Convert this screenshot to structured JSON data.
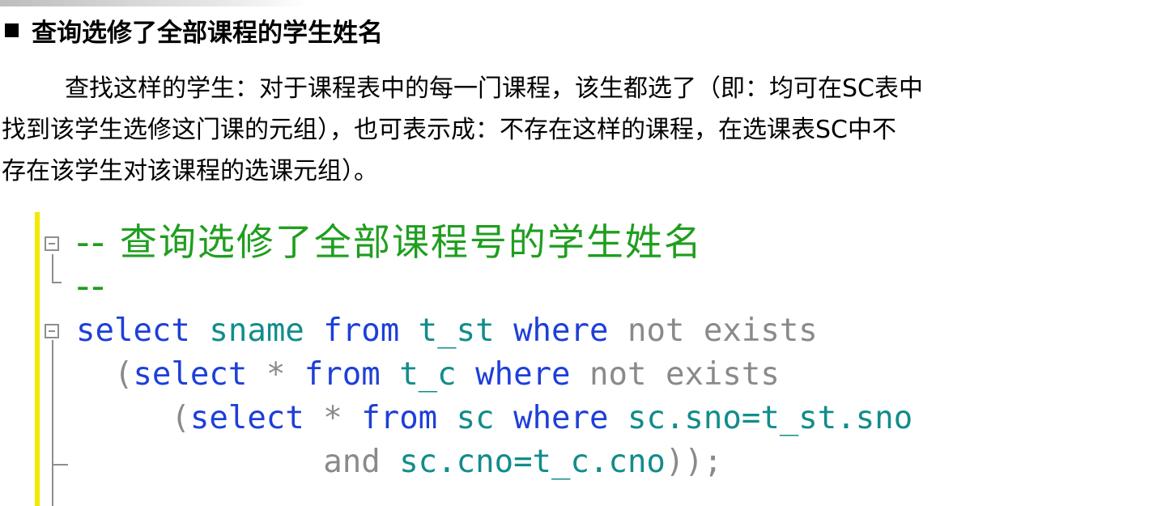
{
  "slide": {
    "heading": "查询选修了全部课程的学生姓名",
    "paragraph_lines": [
      "查找这样的学生：对于课程表中的每一门课程，该生都选了（即：均可在SC表中",
      "找到该学生选修这门课的元组），也可表示成：不存在这样的课程，在选课表SC中不",
      "存在该学生对该课程的选课元组）。"
    ]
  },
  "code": {
    "comment_line": "-- 查询选修了全部课程号的学生姓名",
    "comment_end": "--",
    "line1": {
      "t1": "select",
      "t2": "sname",
      "t3": "from",
      "t4": "t_st",
      "t5": "where",
      "t6": "not",
      "t7": "exists"
    },
    "line2": {
      "t0": "(",
      "t1": "select",
      "t2": "*",
      "t3": "from",
      "t4": "t_c",
      "t5": "where",
      "t6": "not",
      "t7": "exists"
    },
    "line3": {
      "t0": "(",
      "t1": "select",
      "t2": "*",
      "t3": "from",
      "t4": "sc",
      "t5": "where",
      "t6": "sc.sno=t_st.sno"
    },
    "line4": {
      "t1": "and",
      "t2": "sc.cno=t_c.cno",
      "t3": "));"
    }
  },
  "colors": {
    "comment": "#1f9e1f",
    "keyword": "#1e3fd8",
    "identifier": "#128c8c",
    "operator": "#8a8a8a",
    "gutter_marker": "#f2ea00"
  }
}
